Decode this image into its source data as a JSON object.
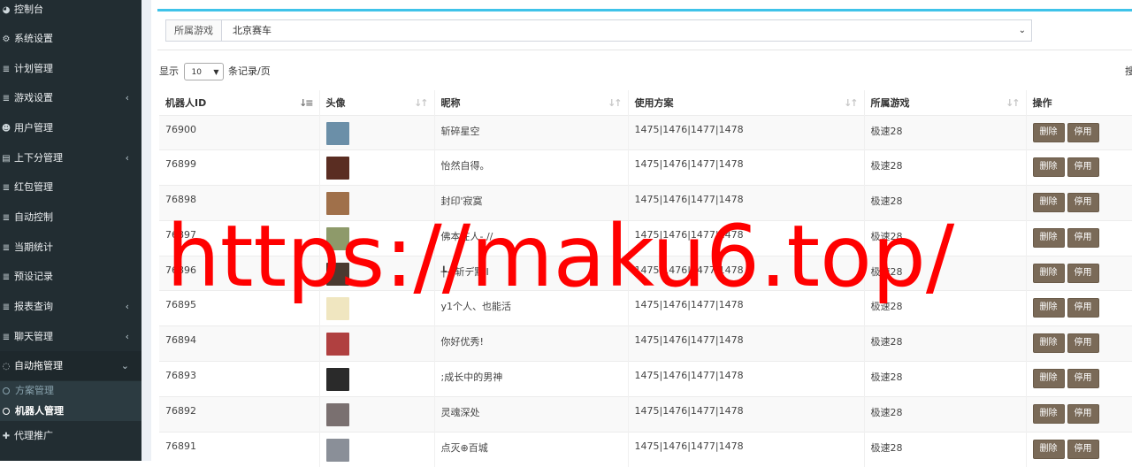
{
  "sidebar": {
    "items": [
      {
        "label": "控制台",
        "icon": "dashboard-icon",
        "caret": ""
      },
      {
        "label": "系统设置",
        "icon": "gears-icon",
        "caret": ""
      },
      {
        "label": "计划管理",
        "icon": "list-icon",
        "caret": ""
      },
      {
        "label": "游戏设置",
        "icon": "list-icon",
        "caret": "‹"
      },
      {
        "label": "用户管理",
        "icon": "users-icon",
        "caret": ""
      },
      {
        "label": "上下分管理",
        "icon": "database-icon",
        "caret": "‹"
      },
      {
        "label": "红包管理",
        "icon": "list-icon",
        "caret": ""
      },
      {
        "label": "自动控制",
        "icon": "list-icon",
        "caret": ""
      },
      {
        "label": "当期统计",
        "icon": "list-icon",
        "caret": ""
      },
      {
        "label": "预设记录",
        "icon": "list-icon",
        "caret": ""
      },
      {
        "label": "报表查询",
        "icon": "list-icon",
        "caret": "‹"
      },
      {
        "label": "聊天管理",
        "icon": "list-icon",
        "caret": "‹"
      },
      {
        "label": "自动拖管理",
        "icon": "chat-icon",
        "caret": "⌄"
      },
      {
        "label": "代理推广",
        "icon": "user-plus-icon",
        "caret": ""
      }
    ],
    "sub_items": [
      {
        "label": "方案管理"
      },
      {
        "label": "机器人管理"
      }
    ]
  },
  "filter": {
    "label": "所属游戏",
    "selected": "北京赛车"
  },
  "length_menu": {
    "prefix": "显示",
    "value": "10",
    "suffix": "条记录/页"
  },
  "search_truncated": "搜",
  "table": {
    "columns": [
      "机器人ID",
      "头像",
      "昵称",
      "使用方案",
      "所属游戏",
      "操作"
    ],
    "delete_label": "删除",
    "disable_label": "停用",
    "rows": [
      {
        "id": "76900",
        "nickname": "斩碎星空",
        "plan": "1475|1476|1477|1478",
        "game": "极速28",
        "avatar_color": "#6b8fa8"
      },
      {
        "id": "76899",
        "nickname": "怡然自得。",
        "plan": "1475|1476|1477|1478",
        "game": "极速28",
        "avatar_color": "#5a2d22"
      },
      {
        "id": "76898",
        "nickname": "封印'寂寞",
        "plan": "1475|1476|1477|1478",
        "game": "极速28",
        "avatar_color": "#a0704a"
      },
      {
        "id": "76897",
        "nickname": "佛本在人- //",
        "plan": "1475|1476|1477|1478",
        "game": "极速28",
        "avatar_color": "#8e9a6a"
      },
      {
        "id": "76896",
        "nickname": "╄→斩デ點Ⅱ",
        "plan": "1475|1476|1477|1478",
        "game": "极速28",
        "avatar_color": "#4a3a30"
      },
      {
        "id": "76895",
        "nickname": "y1个人、也能活",
        "plan": "1475|1476|1477|1478",
        "game": "极速28",
        "avatar_color": "#f0e6c0"
      },
      {
        "id": "76894",
        "nickname": "你好优秀!",
        "plan": "1475|1476|1477|1478",
        "game": "极速28",
        "avatar_color": "#b04040"
      },
      {
        "id": "76893",
        "nickname": ";成长中的男神",
        "plan": "1475|1476|1477|1478",
        "game": "极速28",
        "avatar_color": "#2a2a2a"
      },
      {
        "id": "76892",
        "nickname": "灵魂深处",
        "plan": "1475|1476|1477|1478",
        "game": "极速28",
        "avatar_color": "#7a7070"
      },
      {
        "id": "76891",
        "nickname": "点灭⊕百城",
        "plan": "1475|1476|1477|1478",
        "game": "极速28",
        "avatar_color": "#8a8f98"
      }
    ]
  },
  "watermark": "https://maku6.top/"
}
